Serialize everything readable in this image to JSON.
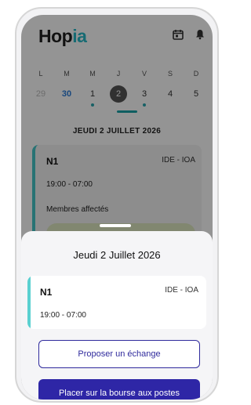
{
  "app": {
    "logo_prefix": "H",
    "logo_main": "op",
    "logo_accent": "ia"
  },
  "header": {
    "icons": [
      "calendar-icon",
      "bell-icon"
    ]
  },
  "week": {
    "days_of_week": [
      "L",
      "M",
      "M",
      "J",
      "V",
      "S",
      "D"
    ],
    "days": [
      {
        "num": "29",
        "state": "muted",
        "dot": false
      },
      {
        "num": "30",
        "state": "today",
        "dot": false
      },
      {
        "num": "1",
        "state": "normal",
        "dot": true
      },
      {
        "num": "2",
        "state": "selected",
        "dot": false
      },
      {
        "num": "3",
        "state": "normal",
        "dot": true
      },
      {
        "num": "4",
        "state": "normal",
        "dot": false
      },
      {
        "num": "5",
        "state": "normal",
        "dot": false
      }
    ]
  },
  "selected_date_label": "JEUDI 2 JUILLET 2026",
  "background_card": {
    "code": "N1",
    "role": "IDE - IOA",
    "hours": "19:00 - 07:00",
    "members_label": "Membres affectés"
  },
  "sheet": {
    "title": "Jeudi 2 Juillet 2026",
    "card": {
      "code": "N1",
      "role": "IDE - IOA",
      "hours": "19:00 - 07:00"
    },
    "propose_label": "Proposer un échange",
    "market_label": "Placer sur la bourse aux postes"
  },
  "colors": {
    "accent_teal": "#46c6c8",
    "primary": "#2e26a6",
    "today_blue": "#2a7bd8"
  }
}
